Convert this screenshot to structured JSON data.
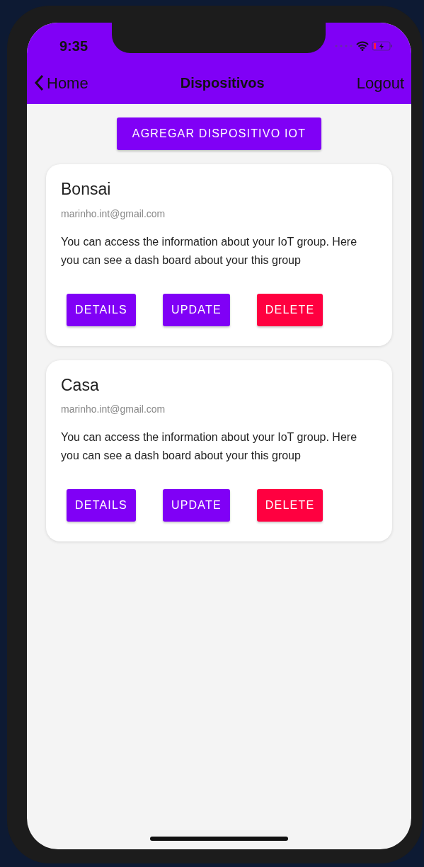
{
  "status_bar": {
    "time": "9:35"
  },
  "nav": {
    "back_label": "Home",
    "title": "Dispositivos",
    "right_action": "Logout"
  },
  "add_button": "AGREGAR DISPOSITIVO IOT",
  "devices": [
    {
      "name": "Bonsai",
      "email": "marinho.int@gmail.com",
      "description": "You can access the information about your IoT group. Here you can see a dash board about your this group",
      "actions": [
        {
          "label": "DETAILS",
          "kind": "primary"
        },
        {
          "label": "UPDATE",
          "kind": "primary"
        },
        {
          "label": "DELETE",
          "kind": "danger"
        }
      ]
    },
    {
      "name": "Casa",
      "email": "marinho.int@gmail.com",
      "description": "You can access the information about your IoT group. Here you can see a dash board about your this group",
      "actions": [
        {
          "label": "DETAILS",
          "kind": "primary"
        },
        {
          "label": "UPDATE",
          "kind": "primary"
        },
        {
          "label": "DELETE",
          "kind": "danger"
        }
      ]
    }
  ]
}
